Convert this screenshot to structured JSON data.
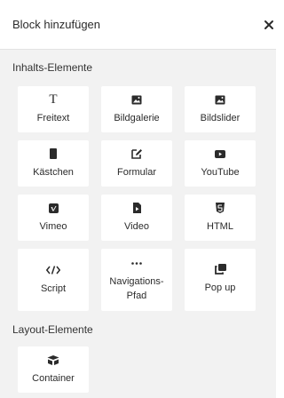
{
  "header": {
    "title": "Block hinzufügen",
    "close_icon": "close-icon"
  },
  "content_section": {
    "title": "Inhalts-Elemente",
    "items": [
      {
        "label": "Freitext",
        "icon": "text-icon"
      },
      {
        "label": "Bildgalerie",
        "icon": "image-icon"
      },
      {
        "label": "Bildslider",
        "icon": "image-icon"
      },
      {
        "label": "Kästchen",
        "icon": "box-icon"
      },
      {
        "label": "Formular",
        "icon": "edit-form-icon"
      },
      {
        "label": "YouTube",
        "icon": "youtube-icon"
      },
      {
        "label": "Vimeo",
        "icon": "vimeo-icon"
      },
      {
        "label": "Video",
        "icon": "video-file-icon"
      },
      {
        "label": "HTML",
        "icon": "html5-icon"
      },
      {
        "label": "Script",
        "icon": "code-icon"
      },
      {
        "label": "Navigations-\nPfad",
        "icon": "ellipsis-icon"
      },
      {
        "label": "Pop up",
        "icon": "popup-window-icon"
      }
    ]
  },
  "layout_section": {
    "title": "Layout-Elemente",
    "items": [
      {
        "label": "Container",
        "icon": "container-icon"
      }
    ]
  }
}
